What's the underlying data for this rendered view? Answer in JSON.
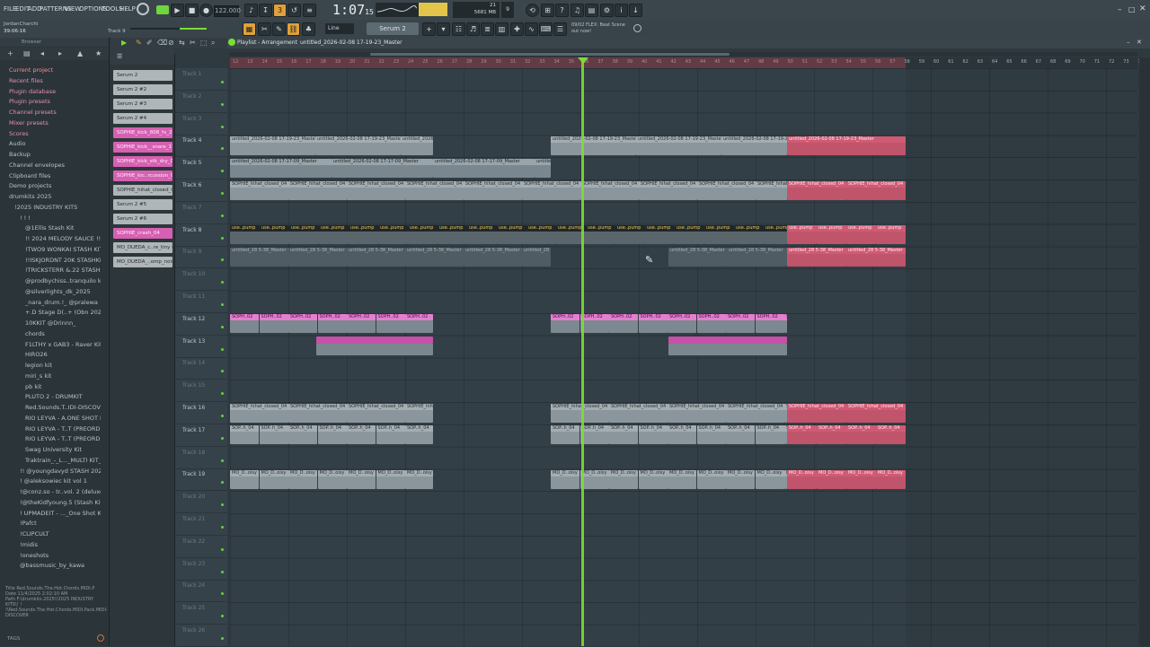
{
  "menu": [
    "FILE",
    "EDIT",
    "ADD",
    "PATTERNS",
    "VIEW",
    "OPTIONS",
    "TOOLS",
    "HELP"
  ],
  "transport": {
    "bpm": "122.000",
    "time": "1:07",
    "time_ticks": "15",
    "pattern": "Serum 2",
    "cpu": "21",
    "mem": "5681 MB",
    "mem2": "9"
  },
  "hint": {
    "line1": "09/02  FLEX: Beat Scene",
    "line2": "out now!"
  },
  "snap": "Line",
  "status": {
    "project": "JordanCharchi",
    "time": "39:06:16",
    "channel": "Track 9"
  },
  "browser": {
    "title": "Browser",
    "items": [
      {
        "label": "Current project",
        "style": "red"
      },
      {
        "label": "Recent files",
        "style": "pink"
      },
      {
        "label": "Plugin database",
        "style": "pink"
      },
      {
        "label": "Plugin presets",
        "style": "pink"
      },
      {
        "label": "Channel presets",
        "style": "pink"
      },
      {
        "label": "Mixer presets",
        "style": "pink"
      },
      {
        "label": "Scores",
        "style": "pink"
      },
      {
        "label": "Audio",
        "style": ""
      },
      {
        "label": "Backup",
        "style": ""
      },
      {
        "label": "Channel envelopes",
        "style": ""
      },
      {
        "label": "Clipboard files",
        "style": ""
      },
      {
        "label": "Demo projects",
        "style": ""
      },
      {
        "label": "drumkits 2025",
        "style": ""
      },
      {
        "label": "!2025 INDUSTRY KITS",
        "style": ""
      },
      {
        "label": "! ! !",
        "style": ""
      },
      {
        "label": "@1Ellis Stash Kit",
        "style": ""
      },
      {
        "label": "!! 2024 MELODY SAUCE !!",
        "style": ""
      },
      {
        "label": "!TWO9 WONKAI STASH KIT",
        "style": ""
      },
      {
        "label": "!!ISKJORDNT 20K STASHKIT",
        "style": ""
      },
      {
        "label": "!TRICKSTERR &.22 STASH KIT",
        "style": ""
      },
      {
        "label": "@prodbychiss..tranquilo kit",
        "style": ""
      },
      {
        "label": "@silverlights_dk_2025",
        "style": ""
      },
      {
        "label": "_nara_drum.!_ @pralewa",
        "style": ""
      },
      {
        "label": "+.D Stage D(..+ (Obn 2025)",
        "style": ""
      },
      {
        "label": "10KKIT @Drinnn_",
        "style": ""
      },
      {
        "label": "chords",
        "style": ""
      },
      {
        "label": "F1LTHY x GAB3 - Raver Kit",
        "style": ""
      },
      {
        "label": "HIRO26",
        "style": ""
      },
      {
        "label": "legion kit",
        "style": ""
      },
      {
        "label": "miri_s kit",
        "style": ""
      },
      {
        "label": "pb kit",
        "style": ""
      },
      {
        "label": "PLUTO 2 - DRUMKIT",
        "style": ""
      },
      {
        "label": "Red.Sounds.T..IDI-DISCOVER",
        "style": ""
      },
      {
        "label": "RIO LEYVA - A.ONE SHOT KIT",
        "style": ""
      },
      {
        "label": "RIO LEYVA - T..T (PREORDER)",
        "style": ""
      },
      {
        "label": "RIO LEYVA - T..T (PREORDER)",
        "style": ""
      },
      {
        "label": "Swag University Kit",
        "style": ""
      },
      {
        "label": "Traktrain_-_L..._MULTI KIT_",
        "style": ""
      },
      {
        "label": "!! @youngdavyd STASH 2025",
        "style": ""
      },
      {
        "label": "! @aleksowiec kit vol 1",
        "style": ""
      },
      {
        "label": "!@conz.so - tr..vol. 2 (deluxe)",
        "style": ""
      },
      {
        "label": "!@theKidfyoung.5 (Stash Kit)",
        "style": ""
      },
      {
        "label": "! UPMADEIT - ..._One Shot Kit",
        "style": ""
      },
      {
        "label": "!Pafct",
        "style": ""
      },
      {
        "label": "!CLIPCULT",
        "style": ""
      },
      {
        "label": "!midis",
        "style": ""
      },
      {
        "label": "!oneshots",
        "style": ""
      },
      {
        "label": "@bassmusic_by_kawa",
        "style": ""
      }
    ],
    "info": {
      "title_label": "Title",
      "title": "Red.Sounds.The.Hot.Chords.MIDI.P",
      "date_label": "Date",
      "date": "11/4/2025 2:02:10 AM",
      "path_label": "Path",
      "path": "F:\\drumkits 2025\\!2025 INDUSTRY KITS\\! ! !\\Red.Sounds.The.Hot.Chords.MIDI.Pack.MIDI-DISCOVER"
    },
    "tags_label": "TAGS"
  },
  "playlist": {
    "title": "Playlist - Arrangement",
    "file": "untitled_2026-02-08 17-19-23_Master"
  },
  "picker": [
    {
      "label": "Serum 2",
      "style": "gray"
    },
    {
      "label": "Serum 2 #2",
      "style": "gray"
    },
    {
      "label": "Serum 2 #3",
      "style": "gray"
    },
    {
      "label": "Serum 2 #4",
      "style": "gray"
    },
    {
      "label": "SOPHIE_kick_808_fx_26",
      "style": "pink"
    },
    {
      "label": "SOPHIE_kick__snare_17",
      "style": "pink"
    },
    {
      "label": "SOPHIE_kick_stk_dry_03",
      "style": "pink"
    },
    {
      "label": "SOPHIE_kic..rcussion_08",
      "style": "pink"
    },
    {
      "label": "SOPHIE_hihat_closed_04",
      "style": "gray"
    },
    {
      "label": "Serum 2 #5",
      "style": "gray"
    },
    {
      "label": "Serum 2 #6",
      "style": "gray"
    },
    {
      "label": "SOPHIE_crash_04",
      "style": "pink"
    },
    {
      "label": "MO_DUEDA_c..re_tiny 82",
      "style": "gray"
    },
    {
      "label": "MO_DUEDA_..omp_noisy",
      "style": "gray"
    }
  ],
  "timeline": [
    "12",
    "13",
    "14",
    "15",
    "16",
    "17",
    "18",
    "19",
    "20",
    "21",
    "22",
    "23",
    "24",
    "25",
    "26",
    "27",
    "28",
    "29",
    "30",
    "31",
    "32",
    "33",
    "34",
    "35",
    "36",
    "37",
    "38",
    "39",
    "40",
    "41",
    "42",
    "43",
    "44",
    "45",
    "46",
    "47",
    "48",
    "49",
    "50",
    "51",
    "52",
    "53",
    "54",
    "55",
    "56",
    "57",
    "58",
    "59",
    "60",
    "61",
    "62",
    "63",
    "64",
    "65",
    "66",
    "67",
    "68",
    "69",
    "70",
    "71",
    "72",
    "73",
    "74",
    "75",
    "76",
    "77",
    "78"
  ],
  "tracks": [
    "Track 1",
    "Track 2",
    "Track 3",
    "Track 4",
    "Track 5",
    "Track 6",
    "Track 7",
    "Track 8",
    "Track 9",
    "Track 10",
    "Track 11",
    "Track 12",
    "Track 13",
    "Track 14",
    "Track 15",
    "Track 16",
    "Track 17",
    "Track 18",
    "Track 19",
    "Track 20",
    "Track 21",
    "Track 22",
    "Track 23",
    "Track 24",
    "Track 25",
    "Track 26"
  ],
  "active_tracks": [
    "Track 4",
    "Track 5",
    "Track 6",
    "Track 8",
    "Track 12",
    "Track 13",
    "Track 16",
    "Track 17",
    "Track 19"
  ],
  "clip_labels": {
    "t4": "untitled_2026-02-08 17-19-23_Master",
    "t5": "untitled_2026-02-08 17-17-09_Master",
    "t6": "SOPHIE_hihat_closed_04",
    "t8": "use..pump",
    "t9": "untitled_28 5-38_Master",
    "t12": "SOPH..02",
    "t16": "SOPHIE_hihat_closed_04",
    "t17": "SOP..h_04",
    "t19": "MO_D..oisy"
  },
  "colors": {
    "accent": "#7adf33",
    "pink": "#d660b2",
    "red": "#c0546b"
  }
}
